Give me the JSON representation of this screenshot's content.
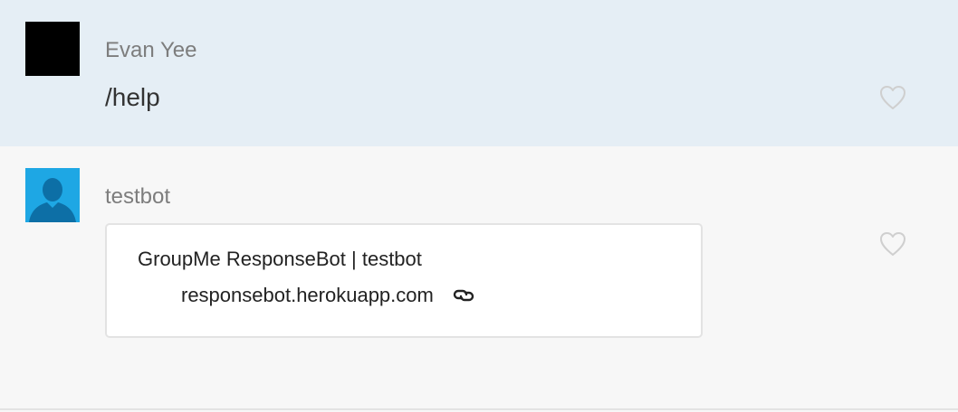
{
  "messages": [
    {
      "author": "Evan Yee",
      "text": "/help",
      "avatar": "black-square-avatar",
      "background": "#e5eef5"
    },
    {
      "author": "testbot",
      "avatar": "default-person-avatar",
      "avatar_color": "#1ea7e4",
      "background": "#f7f7f7",
      "attachment": {
        "title": "GroupMe ResponseBot | testbot",
        "url_text": "responsebot.herokuapp.com",
        "icon": "link-icon"
      }
    }
  ],
  "icons": {
    "like": "heart-icon"
  }
}
